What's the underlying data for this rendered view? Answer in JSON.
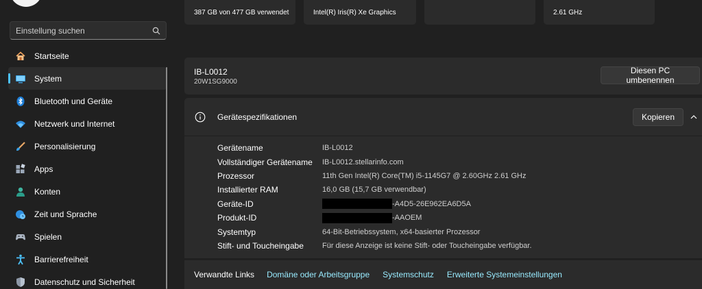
{
  "search": {
    "placeholder": "Einstellung suchen"
  },
  "sidebar": {
    "items": [
      {
        "label": "Startseite",
        "icon": "home-icon"
      },
      {
        "label": "System",
        "icon": "monitor-icon",
        "active": true
      },
      {
        "label": "Bluetooth und Geräte",
        "icon": "bluetooth-icon"
      },
      {
        "label": "Netzwerk und Internet",
        "icon": "wifi-icon"
      },
      {
        "label": "Personalisierung",
        "icon": "brush-icon"
      },
      {
        "label": "Apps",
        "icon": "apps-icon"
      },
      {
        "label": "Konten",
        "icon": "person-icon"
      },
      {
        "label": "Zeit und Sprache",
        "icon": "globe-clock-icon"
      },
      {
        "label": "Spielen",
        "icon": "gamepad-icon"
      },
      {
        "label": "Barrierefreiheit",
        "icon": "accessibility-icon"
      },
      {
        "label": "Datenschutz und Sicherheit",
        "icon": "shield-icon"
      }
    ]
  },
  "top_cards": {
    "storage": "387 GB von 477 GB verwendet",
    "graphics": "Intel(R) Iris(R) Xe Graphics",
    "empty": "",
    "cpu_speed": "2.61 GHz"
  },
  "device": {
    "name": "IB-L0012",
    "model": "20W1SG9000",
    "rename_label": "Diesen PC umbenennen"
  },
  "specs": {
    "title": "Gerätespezifikationen",
    "copy_label": "Kopieren",
    "rows": [
      {
        "label": "Gerätename",
        "value": "IB-L0012"
      },
      {
        "label": "Vollständiger Gerätename",
        "value": "IB-L0012.stellarinfo.com"
      },
      {
        "label": "Prozessor",
        "value": "11th Gen Intel(R) Core(TM) i5-1145G7 @ 2.60GHz   2.61 GHz"
      },
      {
        "label": "Installierter RAM",
        "value": "16,0 GB (15,7 GB verwendbar)"
      },
      {
        "label": "Geräte-ID",
        "value": "-A4D5-26E962EA6D5A"
      },
      {
        "label": "Produkt-ID",
        "value": "-AAOEM"
      },
      {
        "label": "Systemtyp",
        "value": "64-Bit-Betriebssystem, x64-basierter Prozessor"
      },
      {
        "label": "Stift- und Toucheingabe",
        "value": "Für diese Anzeige ist keine Stift- oder Toucheingabe verfügbar."
      }
    ]
  },
  "related": {
    "title": "Verwandte Links",
    "links": [
      "Domäne oder Arbeitsgruppe",
      "Systemschutz",
      "Erweiterte Systemeinstellungen"
    ]
  },
  "colors": {
    "background": "#202020",
    "card": "#2b2b2b",
    "accent": "#4cc2ff",
    "link": "#99ebff"
  }
}
